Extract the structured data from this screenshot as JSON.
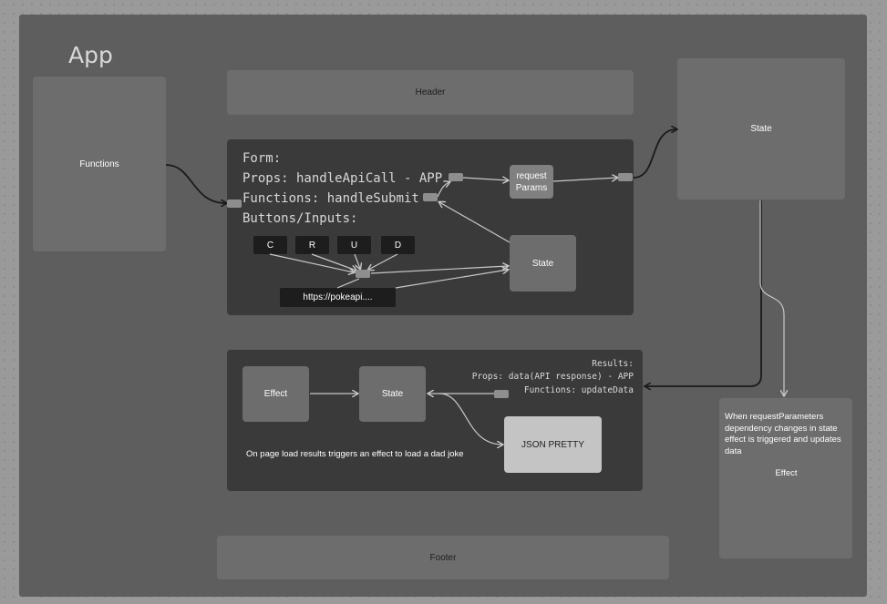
{
  "app": {
    "title": "App"
  },
  "functions_box": {
    "label": "Functions"
  },
  "header": {
    "label": "Header"
  },
  "state_top": {
    "label": "State"
  },
  "form": {
    "lines": [
      "Form:",
      "Props: handleApiCall - APP",
      "Functions: handleSubmit",
      "Buttons/Inputs:"
    ],
    "buttons": [
      "C",
      "R",
      "U",
      "D"
    ],
    "url_label": "https://pokeapi....",
    "request_params": "request\nParams",
    "state_label": "State"
  },
  "results": {
    "lines": [
      "Results:",
      "Props: data(API response) - APP",
      "Functions: updateData"
    ],
    "effect_label": "Effect",
    "state_label": "State",
    "json_label": "JSON PRETTY",
    "note": "On page load results triggers an effect to load a dad joke"
  },
  "effect_panel": {
    "description": "When requestParameters dependency changes in state effect is triggered and updates data",
    "label": "Effect"
  },
  "footer": {
    "label": "Footer"
  },
  "colors": {
    "background": "#9a9a9a",
    "frame": "#5e5e5e",
    "panel": "#3a3a3a",
    "box": "#6d6d6d",
    "wire_dark": "#1a1a1a",
    "wire_light": "#c8c8c8"
  }
}
